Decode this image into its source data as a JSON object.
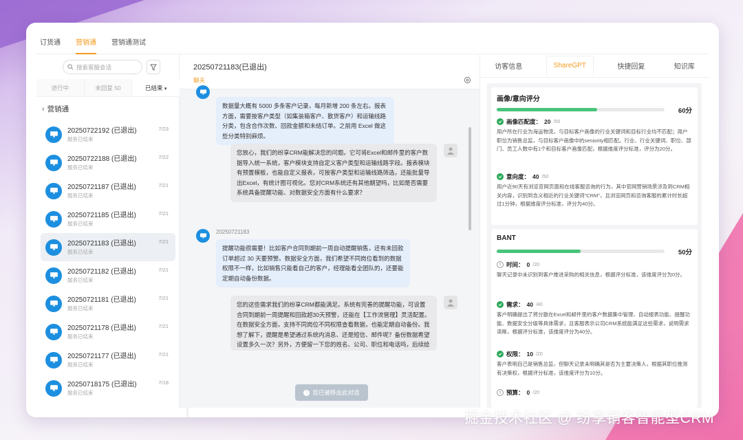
{
  "topnav": {
    "tabs": [
      {
        "label": "订货通"
      },
      {
        "label": "营销通"
      },
      {
        "label": "营销通测试"
      }
    ]
  },
  "left": {
    "search_placeholder": "搜索客服会话",
    "status_tabs": [
      {
        "label": "进行中"
      },
      {
        "label": "未回复 50"
      },
      {
        "label": "已结束"
      }
    ],
    "back_label": "营销通",
    "sessions": [
      {
        "name": "20250722192 (已退出)",
        "sub": "服务已结束",
        "date": "7/23"
      },
      {
        "name": "20250722188 (已退出)",
        "sub": "服务已结束",
        "date": "7/22"
      },
      {
        "name": "20250721187 (已退出)",
        "sub": "服务已结束",
        "date": "7/21"
      },
      {
        "name": "20250721185 (已退出)",
        "sub": "服务已结束",
        "date": "7/21"
      },
      {
        "name": "20250721183 (已退出)",
        "sub": "服务已结束",
        "date": "7/21"
      },
      {
        "name": "20250721182 (已退出)",
        "sub": "服务已结束",
        "date": "7/21"
      },
      {
        "name": "20250721181 (已退出)",
        "sub": "服务已结束",
        "date": "7/21"
      },
      {
        "name": "20250721178 (已退出)",
        "sub": "服务已结束",
        "date": "7/21"
      },
      {
        "name": "20250721177 (已退出)",
        "sub": "服务已结束",
        "date": "7/21"
      },
      {
        "name": "20250718175 (已退出)",
        "sub": "服务已结束",
        "date": "7/18"
      }
    ]
  },
  "chat": {
    "title": "20250721183(已退出)",
    "tab": "聊天",
    "messages": [
      {
        "text": "数据量大概有 5000 多条客户记录，每月新增 200 条左右。报表方面，需要按客户类型（如集装箱客户、散货客户）和运输线路分类，包含合作次数、回款金额和未结订单。之前用 Excel 做这些分类特别麻烦。"
      },
      {
        "text": "您放心，我们的纷享CRM能解决您的问题。它可将Excel和邮件里的客户数据导入统一系统，客户模块支持自定义客户类型和运输线路字段。报表模块有预置模板，也能自定义报表，可按客户类型和运输线路筛选，还能批量导出Excel，有统计图可视化。您对CRM系统还有其他期望吗，比如是否需要系统具备提醒功能、对数据安全方面有什么要求？"
      },
      {
        "time": "2025072118​3",
        "text": "提醒功能很需要！比如客户合同到期前一周自动提醒销售，还有未回款订单超过 30 天要预警。数据安全方面，我们希望不同岗位看到的数据权限不一样，比如销售只能看自己的客户，经理能看全团队的，还要能定期自动备份数据。"
      },
      {
        "text": "您的这些需求我们的纷享CRM都能满足。系统有完善的提醒功能，可设置合同到期前一周提醒和回款超30天预警，还能在【工作流管理】灵活配置。在数据安全方面，支持不同岗位不同权限查看数据，也能定期自动备份。我想了解下，提醒是希望通过系统内消息、还是短信、邮件呢？备份数据希望设置多久一次？另外，方便留一下您的姓名、公司、职位和电话吗，后续给您提供报价？"
      }
    ],
    "moved_notice": "您已被移出此对话"
  },
  "right": {
    "tabs": [
      {
        "label": "访客信息"
      },
      {
        "label": "ShareGPT"
      },
      {
        "label": "快捷回复"
      },
      {
        "label": "知识库"
      }
    ],
    "portrait": {
      "title": "画像/意向评分",
      "score": "60分",
      "progress": 0.6,
      "criteria": [
        {
          "name": "画像匹配度：",
          "value": "20",
          "max": "/50",
          "desc": "用户所在行业为海运物流，与目标客户画像的行业关键词和目标行业均不匹配；用户职位为销售总监，与目标客户画像中的seniority相匹配。行业、行业关键词、职位、部门、员工人数中有1个和目标客户画像匹配，根据维度评分标准，评分为20分。"
        },
        {
          "name": "意向度：",
          "value": "40",
          "max": "/50",
          "desc": "用户近90天有浏览官网页面和在线客服咨询的行为，其中官网营销场景涉及到CRM相关内容，识别到含义相近的行业关键词\"CRM\"，且浏览网页和咨询客服的累计时长超过1分钟，根据维度评分标准，评分为40分。"
        }
      ]
    },
    "bant": {
      "title": "BANT",
      "score": "50分",
      "progress": 0.5,
      "criteria": [
        {
          "name": "时间：",
          "value": "0",
          "max": "/20",
          "desc": "聊天记录中未识别到客户推进采购的相关信息，根据评分标准，该维度评分为0分。",
          "ok": false
        },
        {
          "name": "需求：",
          "value": "40",
          "max": "/40",
          "desc": "客户明确提出了将分散在Excel和邮件里的客户数据集中管理、自动报表功能、提醒功能、数据安全分级等具体需求，且客服表示公司CRM系统能满足这些需求，说明需求清晰，根据评分标准，该维度评分为40分。",
          "ok": true
        },
        {
          "name": "权限：",
          "value": "10",
          "max": "/20",
          "desc": "客户表明自己是销售总监，但聊天记录未明确其是否为主要决策人，根据其职位推测有决策权，根据评分标准，该维度评分为10分。",
          "ok": true
        },
        {
          "name": "预算：",
          "value": "0",
          "max": "/20",
          "desc": "",
          "ok": false
        }
      ]
    }
  },
  "watermark": "掘金技术社区 @ 纷享销客智能型CRM"
}
